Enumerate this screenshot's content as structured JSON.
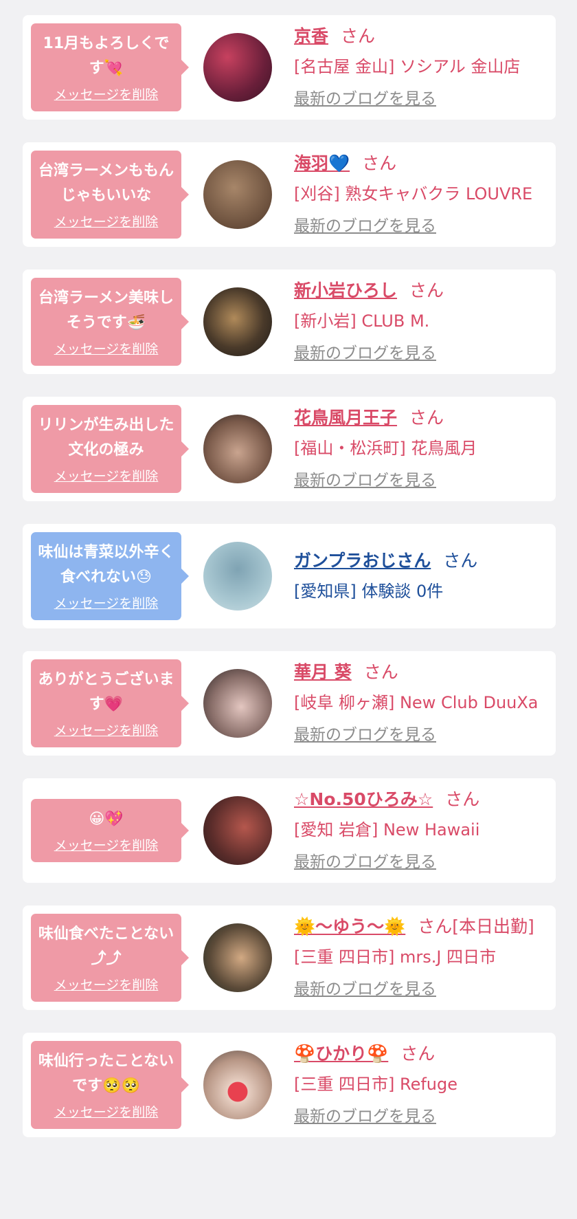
{
  "colors": {
    "pink_bubble": "#ef9aa6",
    "blue_bubble": "#8eb5ef",
    "pink_text": "#d94a67",
    "blue_text": "#1e4f9a",
    "blog_link": "#8c8c8c"
  },
  "delete_label": "メッセージを削除",
  "blog_label": "最新のブログを見る",
  "items": [
    {
      "message": "11月もよろしくです💘",
      "name": "京香",
      "suffix": "さん",
      "shop": "[名古屋 金山] ソシアル 金山店",
      "theme": "pink"
    },
    {
      "message": "台湾ラーメンももんじゃもいいな",
      "name": "海羽💙",
      "suffix": "さん",
      "shop": "[刈谷] 熟女キャバクラ LOUVRE",
      "theme": "pink"
    },
    {
      "message": "台湾ラーメン美味しそうです🍜",
      "name": "新小岩ひろし",
      "suffix": "さん",
      "shop": "[新小岩] CLUB M.",
      "theme": "pink"
    },
    {
      "message": "リリンが生み出した文化の極み",
      "name": "花鳥風月王子",
      "suffix": "さん",
      "shop": "[福山・松浜町] 花鳥風月",
      "theme": "pink"
    },
    {
      "message": "味仙は青菜以外辛く食べれない😓",
      "name": "ガンプラおじさん",
      "suffix": "さん",
      "shop": "[愛知県] 体験談 0件",
      "theme": "blue"
    },
    {
      "message": "ありがとうございます💗",
      "name": "華月 葵",
      "suffix": "さん",
      "shop": "[岐阜 柳ヶ瀬] New Club DuuXa",
      "theme": "pink"
    },
    {
      "message": "😀💖",
      "name": "☆No.50ひろみ☆",
      "suffix": "さん",
      "shop": "[愛知 岩倉] New Hawaii",
      "theme": "pink"
    },
    {
      "message": "味仙食べたことない⤴⤴",
      "name": "🌞〜ゆう〜🌞",
      "suffix": "さん[本日出勤]",
      "shop": "[三重 四日市] mrs.J 四日市",
      "theme": "pink"
    },
    {
      "message": "味仙行ったことないです🥺🥺",
      "name": "🍄ひかり🍄",
      "suffix": "さん",
      "shop": "[三重 四日市] Refuge",
      "theme": "pink"
    }
  ]
}
